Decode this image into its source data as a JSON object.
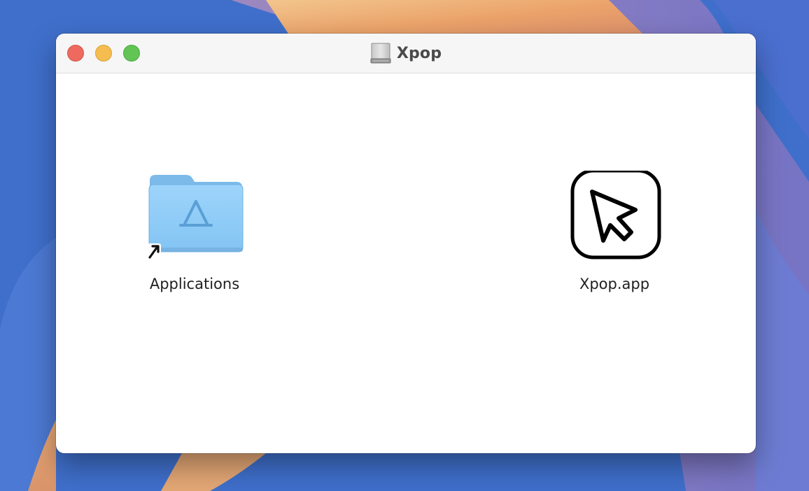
{
  "window": {
    "title": "Xpop",
    "title_icon": "external-disk-icon",
    "traffic_lights": {
      "close": "#ee6a5f",
      "minimize": "#f5bd4f",
      "zoom": "#61c454"
    }
  },
  "items": [
    {
      "label": "Applications",
      "icon": "applications-folder-alias-icon",
      "color": "#8ccbf6"
    },
    {
      "label": "Xpop.app",
      "icon": "xpop-app-cursor-icon",
      "color": "#000000"
    }
  ]
}
